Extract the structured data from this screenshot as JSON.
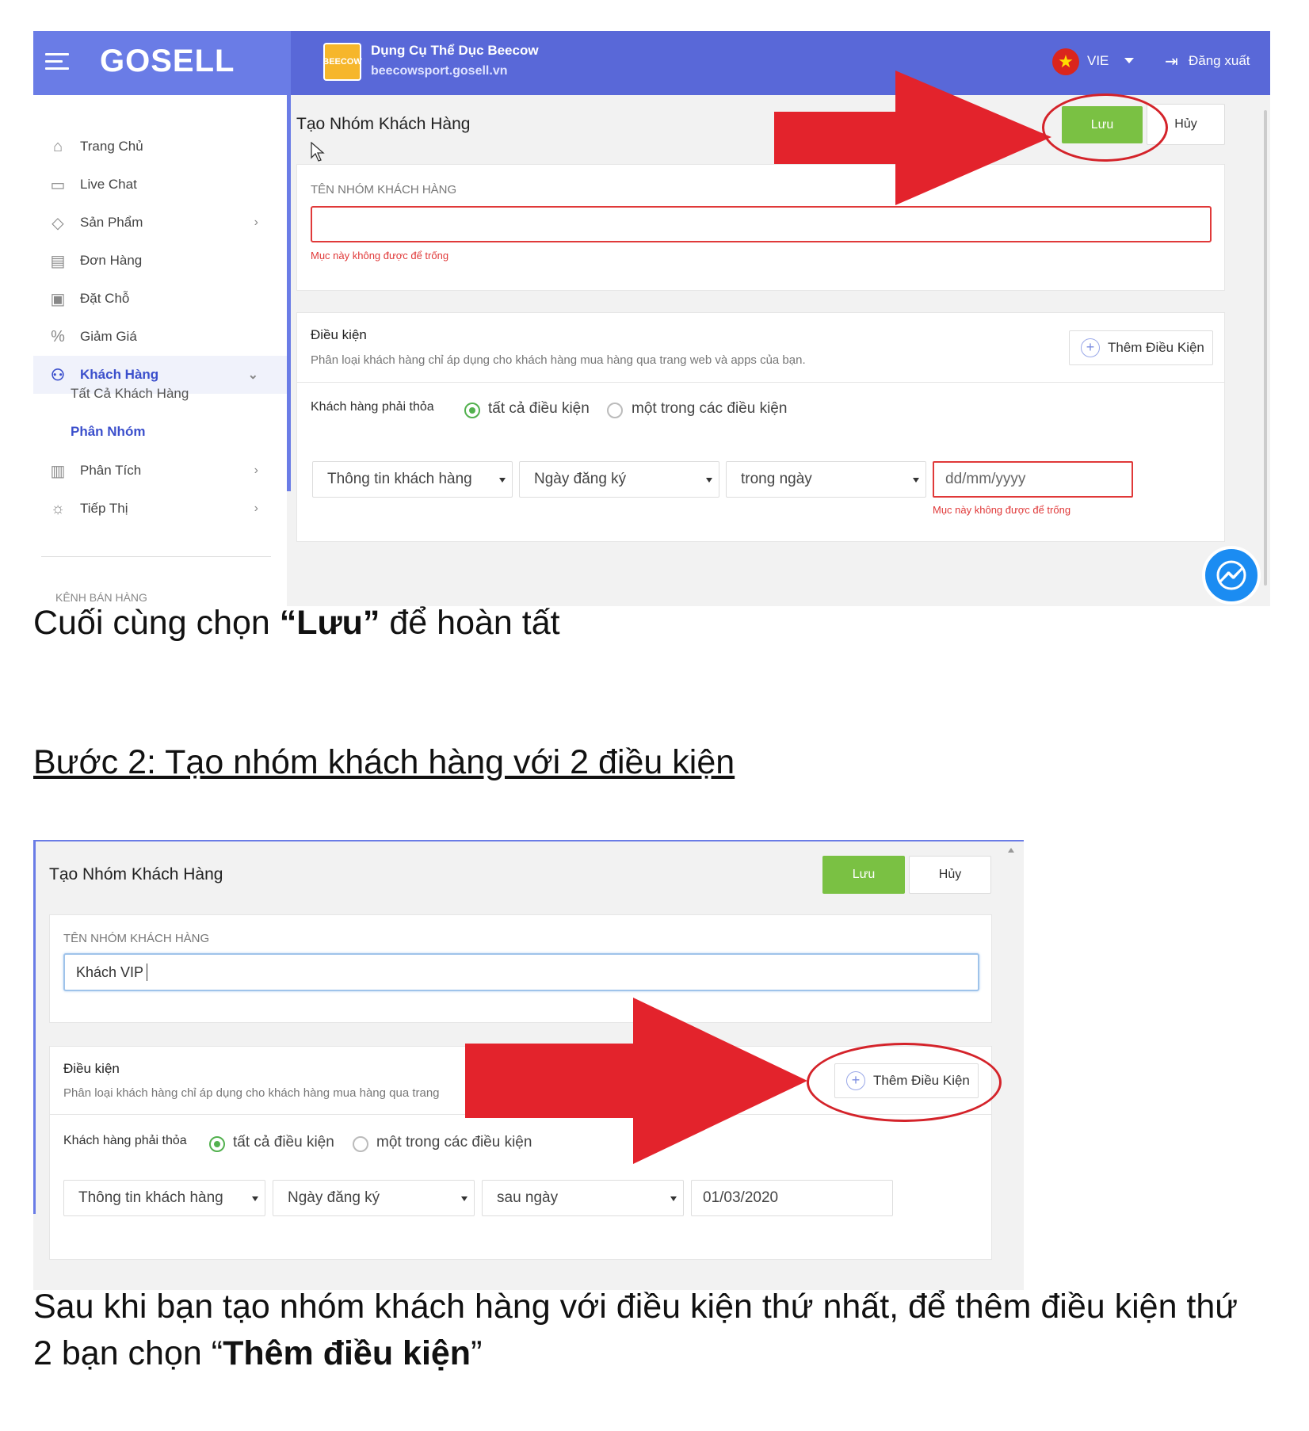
{
  "screenshot1": {
    "brand": {
      "logo_text": "GOSELL"
    },
    "shop": {
      "icon_text": "BEECOW",
      "name": "Dụng Cụ Thể Dục Beecow",
      "url": "beecowsport.gosell.vn"
    },
    "header": {
      "language": "VIE",
      "logout_label": "Đăng xuất"
    },
    "sidebar": {
      "items": [
        {
          "label": "Trang Chủ",
          "icon": "home-icon"
        },
        {
          "label": "Live Chat",
          "icon": "chat-icon"
        },
        {
          "label": "Sản Phẩm",
          "icon": "tag-icon",
          "has_children": true
        },
        {
          "label": "Đơn Hàng",
          "icon": "receipt-icon"
        },
        {
          "label": "Đặt Chỗ",
          "icon": "calendar-icon"
        },
        {
          "label": "Giảm Giá",
          "icon": "percent-icon"
        },
        {
          "label": "Khách Hàng",
          "icon": "users-icon",
          "active": true,
          "expanded": true
        },
        {
          "label": "Phân Tích",
          "icon": "chart-icon",
          "has_children": true
        },
        {
          "label": "Tiếp Thị",
          "icon": "bulb-icon",
          "has_children": true
        }
      ],
      "sub_items": [
        {
          "label": "Tất Cả Khách Hàng"
        },
        {
          "label": "Phân Nhóm",
          "active": true
        }
      ],
      "section_label": "KÊNH BÁN HÀNG"
    },
    "form": {
      "title": "Tạo Nhóm Khách Hàng",
      "save_label": "Lưu",
      "cancel_label": "Hủy",
      "group_name_label": "TÊN NHÓM KHÁCH HÀNG",
      "group_name_value": "",
      "group_name_error": "Mục này không được để trống",
      "conditions_title": "Điều kiện",
      "conditions_desc": "Phân loại khách hàng chỉ áp dụng cho khách hàng mua hàng qua trang web và apps của bạn.",
      "add_condition_label": "Thêm Điều Kiện",
      "must_satisfy_label": "Khách hàng phải thỏa",
      "radio_all": "tất cả điều kiện",
      "radio_any": "một trong các điều kiện",
      "condition": {
        "field": "Thông tin khách hàng",
        "attribute": "Ngày đăng ký",
        "operator": "trong ngày",
        "value_placeholder": "dd/mm/yyyy",
        "value_error": "Mục này không được để trống"
      }
    }
  },
  "caption1": {
    "prefix": "Cuối cùng chọn ",
    "bold": "“Lưu”",
    "suffix": " để hoàn tất"
  },
  "heading2": "Bước 2: Tạo nhóm khách hàng với 2 điều kiện",
  "screenshot2": {
    "form": {
      "title": "Tạo Nhóm Khách Hàng",
      "save_label": "Lưu",
      "cancel_label": "Hủy",
      "group_name_label": "TÊN NHÓM KHÁCH HÀNG",
      "group_name_value": "Khách VIP",
      "conditions_title": "Điều kiện",
      "conditions_desc": "Phân loại khách hàng chỉ áp dụng cho khách hàng mua hàng qua trang",
      "add_condition_label": "Thêm Điều Kiện",
      "must_satisfy_label": "Khách hàng phải thỏa",
      "radio_all": "tất cả điều kiện",
      "radio_any": "một trong các điều kiện",
      "condition": {
        "field": "Thông tin khách hàng",
        "attribute": "Ngày đăng ký",
        "operator": "sau ngày",
        "value": "01/03/2020"
      }
    }
  },
  "caption2": {
    "line1": "Sau khi bạn tạo nhóm khách hàng với điều kiện thứ nhất, để thêm điều kiện thứ",
    "line2_prefix": "2 bạn chọn “",
    "line2_bold": "Thêm điều kiện",
    "line2_suffix": "”"
  },
  "colors": {
    "header_left": "#6a7ce6",
    "header_right": "#5968d8",
    "save_green": "#7ac143",
    "error_red": "#e03939",
    "annotation_red": "#e3232c"
  }
}
